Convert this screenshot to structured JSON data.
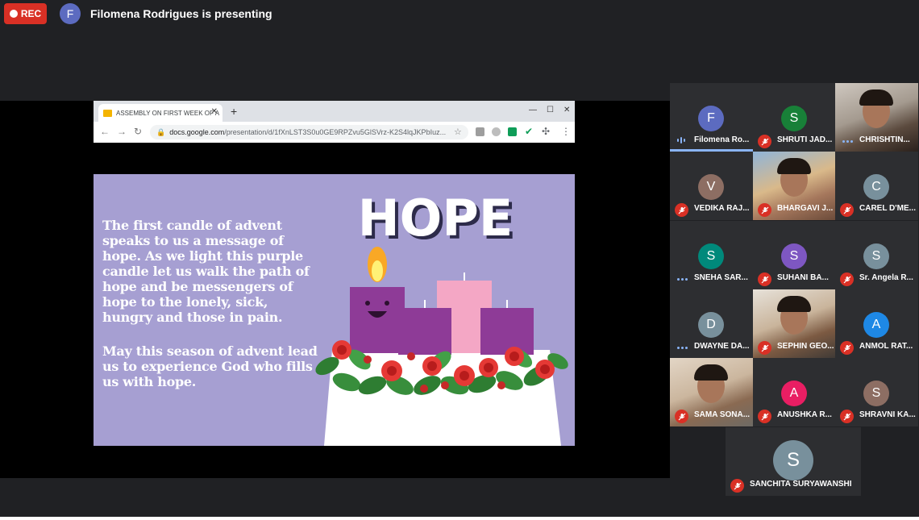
{
  "recording": {
    "label": "REC",
    "color": "#d93025"
  },
  "presenter": {
    "initial": "F",
    "status_text": "Filomena Rodrigues is presenting"
  },
  "browser": {
    "tab_title": "ASSEMBLY ON FIRST WEEK OF A",
    "url_domain": "docs.google.com",
    "url_path": "/presentation/d/1fXnLST3S0u0GE9RPZvu5GlSVrz-K2S4lqJKPbIuz...",
    "icons": [
      "back-icon",
      "forward-icon",
      "reload-icon",
      "lock-icon",
      "star-icon",
      "extensions-icon",
      "menu-icon"
    ]
  },
  "slide": {
    "heading": "HOPE",
    "paragraph1": "The first candle of advent speaks to us a message of hope. As we light this purple candle let us walk the path of hope and be messengers of hope to the lonely, sick, hungry and those in pain.",
    "paragraph2": "May this season of advent lead us to experience God who fills us with hope.",
    "background_color": "#a69fd2"
  },
  "participants": [
    {
      "initial": "F",
      "name": "Filomena Ro...",
      "avatar_color": "#5c6bc0",
      "state": "speaking",
      "video": false
    },
    {
      "initial": "S",
      "name": "SHRUTI JAD...",
      "avatar_color": "#188038",
      "state": "muted",
      "video": false
    },
    {
      "initial": "",
      "name": "CHRISHTIN...",
      "avatar_color": "",
      "state": "talking",
      "video": true
    },
    {
      "initial": "V",
      "name": "VEDIKA RAJ...",
      "avatar_color": "#8d6e63",
      "state": "muted",
      "video": false
    },
    {
      "initial": "",
      "name": "BHARGAVI J...",
      "avatar_color": "",
      "state": "muted",
      "video": true
    },
    {
      "initial": "C",
      "name": "CAREL D'ME...",
      "avatar_color": "#78909c",
      "state": "muted",
      "video": false
    },
    {
      "initial": "S",
      "name": "SNEHA SAR...",
      "avatar_color": "#00897b",
      "state": "talking",
      "video": false
    },
    {
      "initial": "S",
      "name": "SUHANI BA...",
      "avatar_color": "#7e57c2",
      "state": "muted",
      "video": false
    },
    {
      "initial": "S",
      "name": "Sr. Angela R...",
      "avatar_color": "#78909c",
      "state": "muted",
      "video": false
    },
    {
      "initial": "D",
      "name": "DWAYNE DA...",
      "avatar_color": "#78909c",
      "state": "talking",
      "video": false
    },
    {
      "initial": "",
      "name": "SEPHIN GEO...",
      "avatar_color": "",
      "state": "muted",
      "video": true
    },
    {
      "initial": "A",
      "name": "ANMOL RAT...",
      "avatar_color": "#1e88e5",
      "state": "muted",
      "video": false
    },
    {
      "initial": "",
      "name": "SAMA SONA...",
      "avatar_color": "",
      "state": "muted",
      "video": true
    },
    {
      "initial": "A",
      "name": "ANUSHKA R...",
      "avatar_color": "#e91e63",
      "state": "muted",
      "video": false
    },
    {
      "initial": "S",
      "name": "SHRAVNI KA...",
      "avatar_color": "#8d6e63",
      "state": "muted",
      "video": false
    },
    {
      "initial": "S",
      "name": "SANCHITA SURYAWANSHI",
      "avatar_color": "#78909c",
      "state": "muted",
      "video": false
    }
  ]
}
